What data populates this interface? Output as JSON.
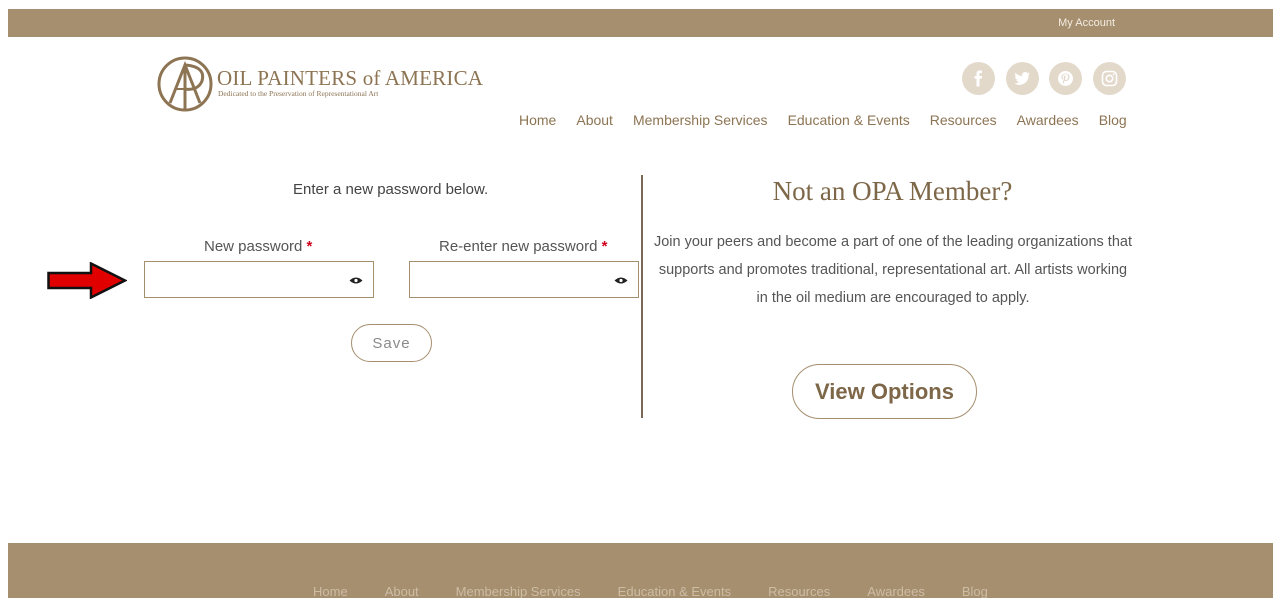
{
  "topbar": {
    "account_link": "My Account"
  },
  "logo": {
    "name": "OIL PAINTERS of AMERICA",
    "tagline": "Dedicated to the Preservation of Representational Art"
  },
  "social": [
    "facebook-icon",
    "twitter-icon",
    "pinterest-icon",
    "instagram-icon"
  ],
  "nav": {
    "items": [
      "Home",
      "About",
      "Membership Services",
      "Education & Events",
      "Resources",
      "Awardees",
      "Blog"
    ]
  },
  "form": {
    "intro": "Enter a new password below.",
    "new_password_label": "New password",
    "reenter_password_label": "Re-enter new password",
    "required_mark": "*",
    "new_password_value": "",
    "reenter_password_value": "",
    "save_label": "Save"
  },
  "promo": {
    "title": "Not an OPA Member?",
    "text": "Join your peers and become a part of one of the leading organizations that supports and promotes traditional, representational art. All artists working in the oil medium are encouraged to apply.",
    "button_label": "View Options"
  },
  "footer": {
    "items": [
      "Home",
      "About",
      "Membership Services",
      "Education & Events",
      "Resources",
      "Awardees",
      "Blog"
    ]
  },
  "colors": {
    "brand": "#a68f6f",
    "accent_text": "#8d7453",
    "required": "#d0021b",
    "arrow": "#e00000"
  }
}
